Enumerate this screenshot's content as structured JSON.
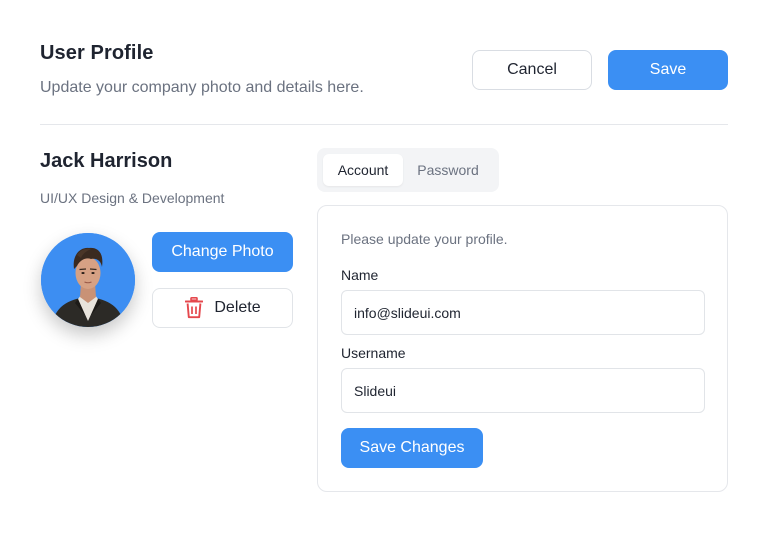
{
  "header": {
    "title": "User Profile",
    "subtitle": "Update your company photo and details here.",
    "cancel_label": "Cancel",
    "save_label": "Save"
  },
  "profile": {
    "name": "Jack Harrison",
    "role": "UI/UX Design & Development",
    "change_photo_label": "Change Photo",
    "delete_label": "Delete",
    "delete_icon": "trash-icon",
    "delete_icon_color": "#e5484d",
    "avatar_bg_color": "#3d8ef2"
  },
  "tabs": [
    {
      "label": "Account",
      "active": true
    },
    {
      "label": "Password",
      "active": false
    }
  ],
  "form": {
    "hint": "Please update your profile.",
    "name_label": "Name",
    "name_value": "info@slideui.com",
    "username_label": "Username",
    "username_value": "Slideui",
    "submit_label": "Save Changes"
  },
  "colors": {
    "accent": "#3b8ff3",
    "text_primary": "#1f2430",
    "text_secondary": "#6b7280",
    "border": "#e5e7eb"
  }
}
